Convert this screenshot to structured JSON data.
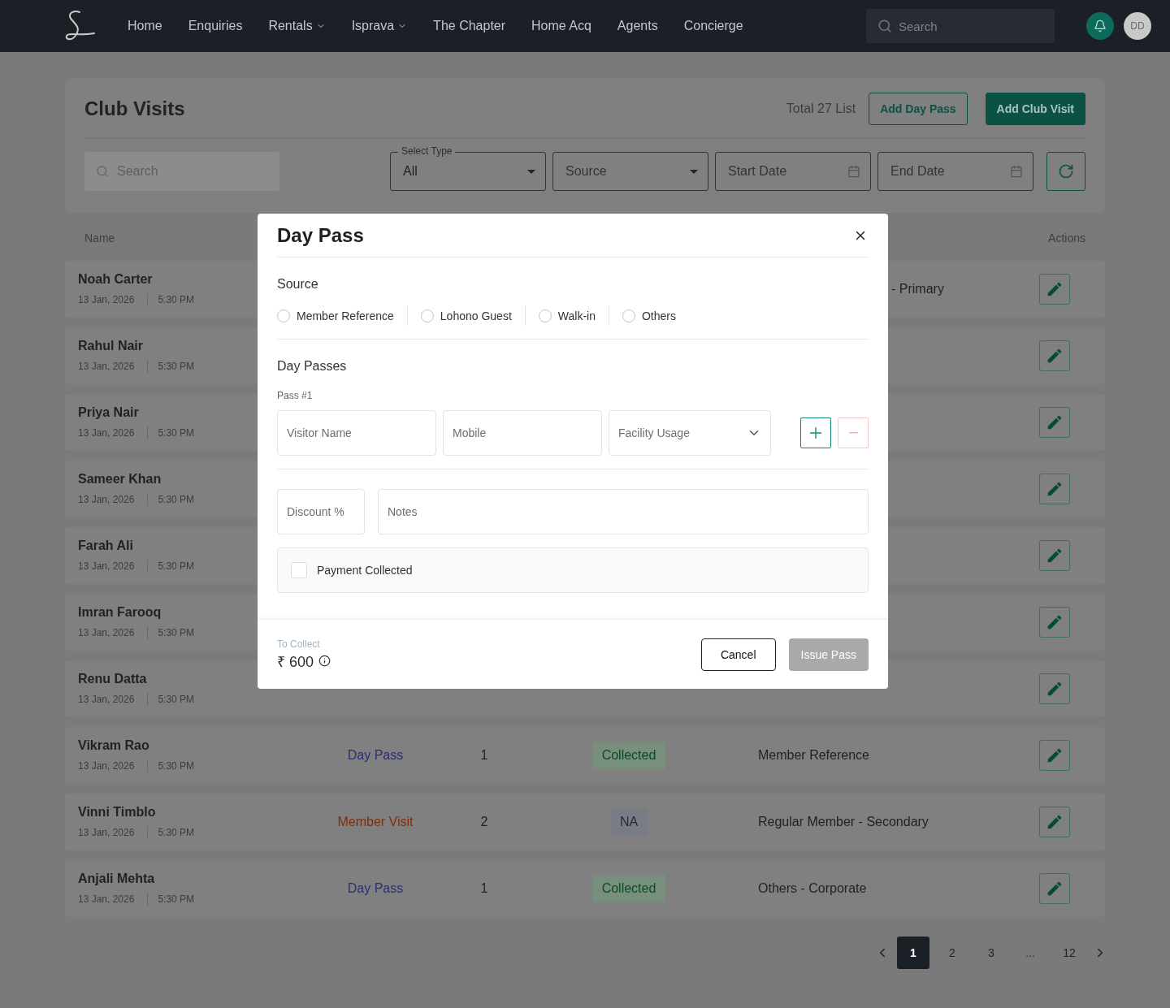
{
  "nav": {
    "items": [
      {
        "label": "Home",
        "dropdown": false
      },
      {
        "label": "Enquiries",
        "dropdown": false
      },
      {
        "label": "Rentals",
        "dropdown": true
      },
      {
        "label": "Isprava",
        "dropdown": true
      },
      {
        "label": "The Chapter",
        "dropdown": false
      },
      {
        "label": "Home Acq",
        "dropdown": false
      },
      {
        "label": "Agents",
        "dropdown": false
      },
      {
        "label": "Concierge",
        "dropdown": false
      }
    ],
    "search": {
      "placeholder": "Search"
    },
    "avatar": "DD"
  },
  "header": {
    "title": "Club Visits",
    "total": "Total 27 List",
    "buttons": [
      {
        "label": "Add Day Pass",
        "kind": "outline"
      },
      {
        "label": "Add Club Visit",
        "kind": "filled"
      }
    ]
  },
  "filters": {
    "search": {
      "placeholder": "Search"
    },
    "select_type": {
      "label": "Select Type",
      "value": "All"
    },
    "source": {
      "placeholder": "Source"
    },
    "start_date": {
      "placeholder": "Start Date"
    },
    "end_date": {
      "placeholder": "End Date"
    }
  },
  "table": {
    "columns": [
      "Name",
      "Actions"
    ],
    "rows": [
      {
        "name": "Noah Carter",
        "date": "13 Jan, 2026",
        "time": "5:30 PM",
        "source_fragment": "- Primary"
      },
      {
        "name": "Rahul Nair",
        "date": "13 Jan, 2026",
        "time": "5:30 PM"
      },
      {
        "name": "Priya Nair",
        "date": "13 Jan, 2026",
        "time": "5:30 PM"
      },
      {
        "name": "Sameer Khan",
        "date": "13 Jan, 2026",
        "time": "5:30 PM"
      },
      {
        "name": "Farah Ali",
        "date": "13 Jan, 2026",
        "time": "5:30 PM"
      },
      {
        "name": "Imran Farooq",
        "date": "13 Jan, 2026",
        "time": "5:30 PM"
      },
      {
        "name": "Renu Datta",
        "date": "13 Jan, 2026",
        "time": "5:30 PM"
      },
      {
        "name": "Vikram Rao",
        "date": "13 Jan, 2026",
        "time": "5:30 PM",
        "type": {
          "text": "Day Pass",
          "kind": "day_pass"
        },
        "count": "1",
        "payment": {
          "text": "Collected",
          "kind": "collected"
        },
        "source": "Member Reference"
      },
      {
        "name": "Vinni Timblo",
        "date": "13 Jan, 2026",
        "time": "5:30 PM",
        "type": {
          "text": "Member Visit",
          "kind": "member_visit"
        },
        "count": "2",
        "payment": {
          "text": "NA",
          "kind": "na"
        },
        "source": "Regular Member - Secondary"
      },
      {
        "name": "Anjali Mehta",
        "date": "13 Jan, 2026",
        "time": "5:30 PM",
        "type": {
          "text": "Day Pass",
          "kind": "day_pass"
        },
        "count": "1",
        "payment": {
          "text": "Collected",
          "kind": "collected"
        },
        "source": "Others - Corporate"
      }
    ]
  },
  "pagination": {
    "pages": [
      {
        "label": "1",
        "kind": "page",
        "selected": true
      },
      {
        "label": "2",
        "kind": "page",
        "selected": false
      },
      {
        "label": "3",
        "kind": "page",
        "selected": false
      },
      {
        "label": "...",
        "kind": "ellipsis"
      },
      {
        "label": "12",
        "kind": "page",
        "selected": false
      }
    ]
  },
  "dialog": {
    "title": "Day Pass",
    "source": {
      "label": "Source",
      "options": [
        {
          "label": "Member Reference",
          "selected": false
        },
        {
          "label": "Lohono Guest",
          "selected": false
        },
        {
          "label": "Walk-in",
          "selected": false
        },
        {
          "label": "Others",
          "selected": false
        }
      ]
    },
    "passes": {
      "label": "Day Passes",
      "items": [
        {
          "label": "Pass #1",
          "visitor_name": {
            "placeholder": "Visitor Name"
          },
          "mobile": {
            "placeholder": "Mobile"
          },
          "facility": {
            "placeholder": "Facility Usage"
          },
          "remove_disabled": true
        }
      ]
    },
    "discount": {
      "placeholder": "Discount %"
    },
    "notes": {
      "placeholder": "Notes"
    },
    "payment_collected": {
      "label": "Payment Collected",
      "checked": false
    },
    "footer": {
      "to_collect_label": "To Collect",
      "amount": "₹ 600",
      "buttons": [
        {
          "label": "Cancel",
          "disabled": false
        },
        {
          "label": "Issue Pass",
          "disabled": true
        }
      ]
    }
  }
}
